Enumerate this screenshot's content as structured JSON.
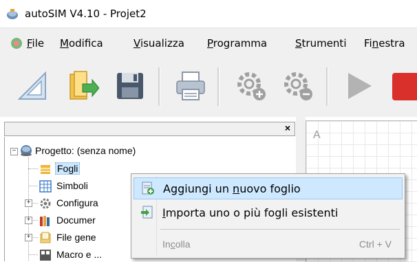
{
  "window": {
    "title": "autoSIM  V4.10 - Projet2"
  },
  "menubar": {
    "items": [
      {
        "u": "F",
        "rest": "ile"
      },
      {
        "u": "M",
        "rest": "odifica"
      },
      {
        "u": "V",
        "rest": "isualizza"
      },
      {
        "u": "P",
        "rest": "rogramma"
      },
      {
        "u": "S",
        "rest": "trumenti"
      },
      {
        "pre": "Fi",
        "u": "n",
        "rest": "estra"
      }
    ]
  },
  "toolbar": {
    "icons": [
      "ruler-triangle-icon",
      "open-folder-icon",
      "save-icon",
      "print-icon",
      "gear-add-icon",
      "gear-remove-icon",
      "play-icon",
      "stop-icon"
    ]
  },
  "panel": {
    "close_glyph": "×"
  },
  "tree": {
    "root": "Progetto: (senza nome)",
    "items": [
      {
        "label": "Fogli",
        "selected": true
      },
      {
        "label": "Simboli"
      },
      {
        "label": "Configura"
      },
      {
        "label": "Documer"
      },
      {
        "label": "File gene"
      },
      {
        "label": "Macro e ..."
      }
    ]
  },
  "canvas": {
    "column_label": "A"
  },
  "context_menu": {
    "add_sheet": {
      "pre": "Aggiungi un ",
      "u": "n",
      "rest": "uovo foglio"
    },
    "import_sheets": {
      "pre": "",
      "u": "I",
      "rest": "mporta uno o più fogli esistenti"
    },
    "paste": {
      "pre": "In",
      "u": "c",
      "rest": "olla",
      "shortcut": "Ctrl + V"
    }
  },
  "colors": {
    "highlight": "#cde8ff",
    "accent_red": "#d9302b",
    "accent_green": "#44a047"
  }
}
